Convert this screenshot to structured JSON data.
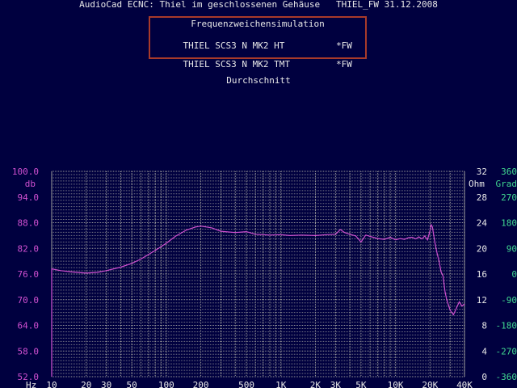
{
  "header": {
    "title": "AudioCad ECNC: Thiel im geschlossenen Gehäuse   THIEL_FW 31.12.2008"
  },
  "legend": {
    "title": "Frequenzweichensimulation",
    "rows": [
      {
        "name": "THIEL SCS3 N MK2 HT",
        "tag": "*FW"
      },
      {
        "name": "THIEL SCS3 N MK2 TMT",
        "tag": "*FW"
      }
    ]
  },
  "subtitle": "Durchschnitt",
  "colors": {
    "background": "#00003f",
    "grid": "#9a9a9a",
    "db_axis": "#d050d0",
    "ohm_axis": "#e8e8e8",
    "grad_axis": "#40d890",
    "curve": "#d050d0",
    "legend_border": "#a83a2a"
  },
  "chart_data": {
    "type": "line",
    "x_scale": "log",
    "xlim": [
      10,
      40000
    ],
    "x_ticks": [
      {
        "v": 10,
        "label": "10"
      },
      {
        "v": 20,
        "label": "20"
      },
      {
        "v": 30,
        "label": "30"
      },
      {
        "v": 50,
        "label": "50"
      },
      {
        "v": 100,
        "label": "100"
      },
      {
        "v": 200,
        "label": "200"
      },
      {
        "v": 500,
        "label": "500"
      },
      {
        "v": 1000,
        "label": "1K"
      },
      {
        "v": 2000,
        "label": "2K"
      },
      {
        "v": 3000,
        "label": "3K"
      },
      {
        "v": 5000,
        "label": "5K"
      },
      {
        "v": 10000,
        "label": "10K"
      },
      {
        "v": 20000,
        "label": "20K"
      },
      {
        "v": 40000,
        "label": "40K"
      }
    ],
    "x_unit": "Hz",
    "y_left": {
      "unit": "db",
      "ylim": [
        52,
        100
      ],
      "ticks": [
        "52.0",
        "58.0",
        "64.0",
        "70.0",
        "76.0",
        "82.0",
        "88.0",
        "94.0",
        "100.0"
      ]
    },
    "y_right1": {
      "unit": "Ohm",
      "ylim": [
        0,
        32
      ],
      "ticks": [
        "0",
        "4",
        "8",
        "12",
        "16",
        "20",
        "24",
        "28",
        "32"
      ]
    },
    "y_right2": {
      "unit": "Grad",
      "ylim": [
        -360,
        360
      ],
      "ticks": [
        "-360",
        "-270",
        "-180",
        "-90",
        "0",
        "90",
        "180",
        "270",
        "360"
      ]
    },
    "grid": true,
    "series": [
      {
        "x": [
          10,
          12,
          15,
          20,
          25,
          30,
          40,
          50,
          60,
          80,
          100,
          120,
          150,
          180,
          200,
          250,
          300,
          400,
          500,
          600,
          700,
          800,
          1000,
          1200,
          1500,
          2000,
          2500,
          3000,
          3300,
          3600,
          4000,
          4500,
          5000,
          5500,
          6000,
          7000,
          8000,
          9000,
          10000,
          11000,
          12000,
          13000,
          14000,
          15000,
          16000,
          17000,
          18000,
          19000,
          20000,
          20500,
          21000,
          22000,
          23000,
          24000,
          25000,
          26000,
          27000,
          28000,
          30000,
          32000,
          34000,
          36000,
          38000,
          40000
        ],
        "y": [
          77.2,
          76.8,
          76.5,
          76.2,
          76.4,
          76.8,
          77.6,
          78.5,
          79.5,
          81.5,
          83.2,
          84.8,
          86.3,
          87.0,
          87.2,
          86.8,
          86.0,
          85.7,
          85.9,
          85.3,
          85.2,
          85.1,
          85.2,
          85.0,
          85.1,
          85.0,
          85.2,
          85.3,
          86.4,
          85.7,
          85.3,
          84.9,
          83.5,
          85.1,
          84.8,
          84.3,
          84.1,
          84.6,
          84.0,
          84.3,
          84.1,
          84.5,
          84.6,
          84.2,
          84.7,
          84.2,
          84.9,
          84.0,
          86.1,
          87.5,
          87.0,
          83.5,
          81.0,
          79.0,
          76.5,
          75.5,
          72.0,
          70.0,
          67.5,
          66.5,
          68.0,
          69.5,
          68.5,
          69.0
        ]
      }
    ]
  }
}
